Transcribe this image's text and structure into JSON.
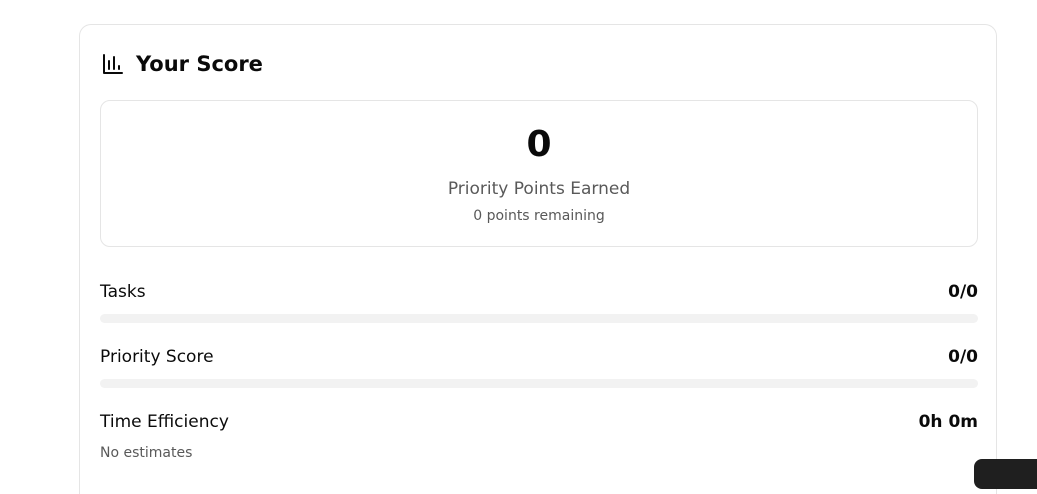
{
  "card": {
    "title": "Your Score",
    "icon": "bar-chart-icon"
  },
  "score": {
    "value": "0",
    "label": "Priority Points Earned",
    "remaining": "0 points remaining"
  },
  "metrics": {
    "tasks": {
      "label": "Tasks",
      "value": "0/0",
      "progress": 0
    },
    "priority": {
      "label": "Priority Score",
      "value": "0/0",
      "progress": 0
    },
    "time": {
      "label": "Time Efficiency",
      "value": "0h 0m",
      "note": "No estimates"
    }
  },
  "colors": {
    "border": "#e5e5e5",
    "track": "#f2f2f2",
    "muted_text": "#595959",
    "text": "#0a0a0a"
  }
}
